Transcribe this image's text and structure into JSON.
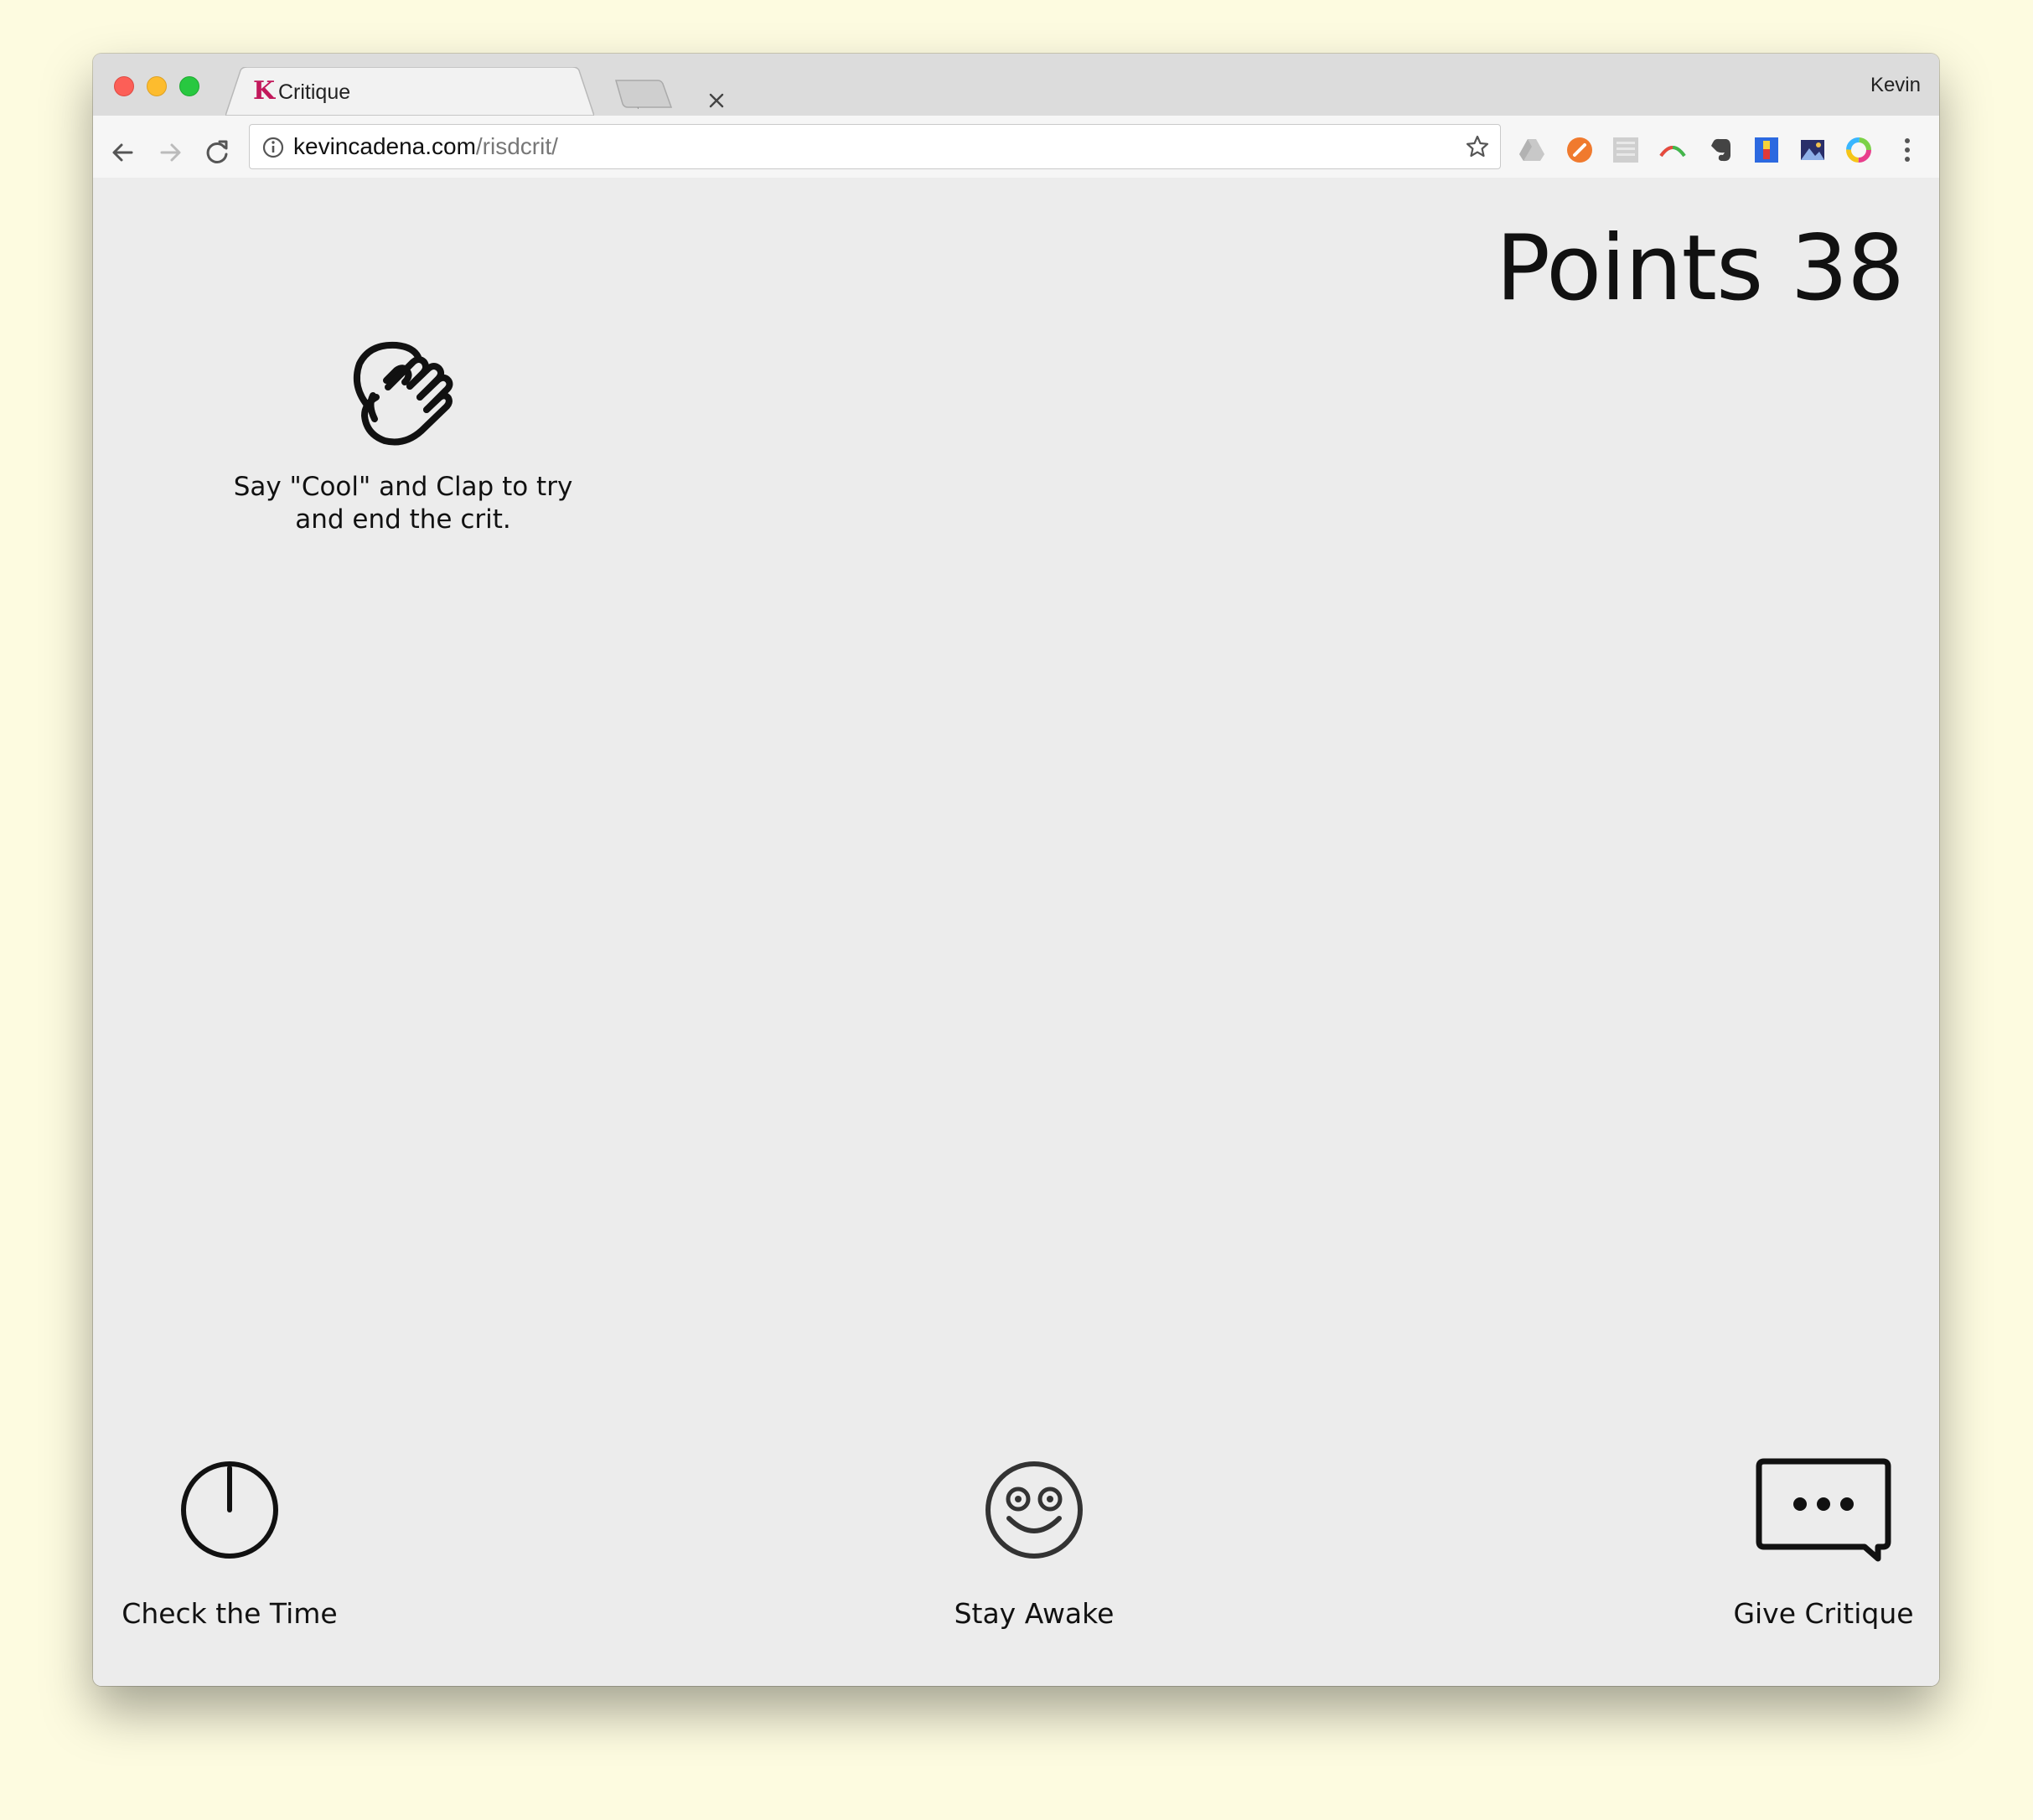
{
  "browser": {
    "tab": {
      "favicon_letter": "K",
      "title": "Critique"
    },
    "profile_name": "Kevin",
    "address_bar": {
      "host": "kevincadena.com",
      "path": "/risdcrit/"
    },
    "extension_icons": [
      "google-drive-icon",
      "orange-extension-icon",
      "grid-extension-icon",
      "arc-extension-icon",
      "evernote-icon",
      "colorzilla-icon",
      "photo-extension-icon",
      "color-wheel-icon"
    ]
  },
  "game": {
    "points_label": "Points 38",
    "clap_prompt": "Say \"Cool\" and Clap to try and end the crit.",
    "actions": {
      "check_time": "Check the Time",
      "stay_awake": "Stay Awake",
      "give_critique": "Give Critique"
    }
  },
  "colors": {
    "page_background": "#ececec",
    "desktop_background": "#fdfbe0",
    "favicon": "#c2185b",
    "text": "#111111"
  }
}
